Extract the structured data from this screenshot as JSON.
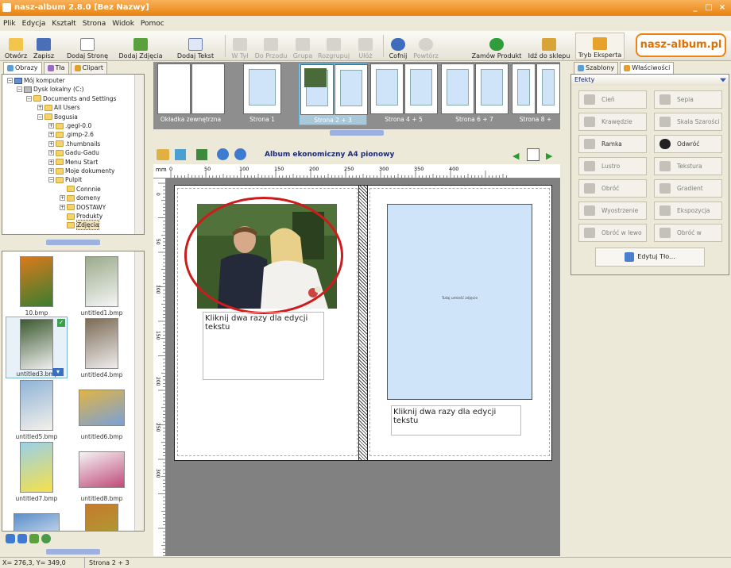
{
  "window": {
    "title": "nasz-album 2.8.0 [Bez Nazwy]",
    "controls": [
      "_",
      "□",
      "×"
    ]
  },
  "menu": [
    "Plik",
    "Edycja",
    "Kształt",
    "Strona",
    "Widok",
    "Pomoc"
  ],
  "toolbar": {
    "open": "Otwórz",
    "save": "Zapisz",
    "add_page": "Dodaj Stronę",
    "add_photos": "Dodaj Zdjęcia",
    "add_text": "Dodaj Tekst",
    "to_back": "W Tył",
    "to_front": "Do Przodu",
    "group": "Grupa",
    "ungroup": "Rozgrupuj",
    "arrange": "Ułóż",
    "undo": "Cofnij",
    "redo": "Powtórz",
    "order_product": "Zamów Produkt",
    "go_to_shop": "Idź do sklepu",
    "expert_mode": "Tryb Eksperta",
    "logo": "nasz-album.pl"
  },
  "left_tabs": [
    "Obrazy",
    "Tła",
    "Clipart"
  ],
  "tree": [
    {
      "label": "Mój komputer",
      "level": 0,
      "kind": "pc",
      "expander": "−"
    },
    {
      "label": "Dysk lokalny (C:)",
      "level": 1,
      "kind": "drive",
      "expander": "−"
    },
    {
      "label": "Documents and Settings",
      "level": 2,
      "kind": "folder",
      "expander": "−"
    },
    {
      "label": "All Users",
      "level": 3,
      "kind": "folder",
      "expander": "+"
    },
    {
      "label": "Bogusia",
      "level": 3,
      "kind": "folder",
      "expander": "−"
    },
    {
      "label": ".gegl-0.0",
      "level": 4,
      "kind": "folder",
      "expander": "+"
    },
    {
      "label": ".gimp-2.6",
      "level": 4,
      "kind": "folder",
      "expander": "+"
    },
    {
      "label": ".thumbnails",
      "level": 4,
      "kind": "folder",
      "expander": "+"
    },
    {
      "label": "Gadu-Gadu",
      "level": 4,
      "kind": "folder",
      "expander": "+"
    },
    {
      "label": "Menu Start",
      "level": 4,
      "kind": "folder",
      "expander": "+"
    },
    {
      "label": "Moje dokumenty",
      "level": 4,
      "kind": "folder",
      "expander": "+"
    },
    {
      "label": "Pulpit",
      "level": 4,
      "kind": "folder",
      "expander": "−"
    },
    {
      "label": "Connnie",
      "level": 5,
      "kind": "folder",
      "expander": ""
    },
    {
      "label": "domeny",
      "level": 5,
      "kind": "folder",
      "expander": "+"
    },
    {
      "label": "DOSTAWY",
      "level": 5,
      "kind": "folder",
      "expander": "+"
    },
    {
      "label": "Produkty",
      "level": 5,
      "kind": "folder",
      "expander": ""
    },
    {
      "label": "Zdjęcia",
      "level": 5,
      "kind": "folder",
      "expander": "",
      "selected": true
    }
  ],
  "thumbnails": [
    {
      "label": "10.bmp"
    },
    {
      "label": "untitled1.bmp"
    },
    {
      "label": "untitled3.bmp",
      "selected": true
    },
    {
      "label": "untitled4.bmp"
    },
    {
      "label": "untitled5.bmp"
    },
    {
      "label": "untitled6.bmp"
    },
    {
      "label": "untitled7.bmp"
    },
    {
      "label": "untitled8.bmp"
    },
    {
      "label": ""
    },
    {
      "label": ""
    }
  ],
  "pages": [
    "Okładka zewnętrzna",
    "Strona 1",
    "Strona 2 + 3",
    "Strona 4 + 5",
    "Strona 6 + 7",
    "Strona 8 +"
  ],
  "editor": {
    "album_title": "Album ekonomiczny A4 pionowy",
    "ruler_unit": "mm",
    "ruler_h": [
      "0",
      "50",
      "100",
      "150",
      "200",
      "250",
      "300",
      "350",
      "400"
    ],
    "ruler_v": [
      "0",
      "50",
      "100",
      "150",
      "200",
      "250",
      "300"
    ]
  },
  "spread": {
    "text_left": "Kliknij dwa razy dla edycji tekstu",
    "placeholder": "Tutaj umieść zdjęcie",
    "text_right": "Kliknij dwa razy dla edycji tekstu"
  },
  "right_tabs": [
    "Szablony",
    "Właściwości"
  ],
  "effects": {
    "header": "Efekty",
    "items": [
      "Cień",
      "Sepia",
      "Krawędzie",
      "Skala Szarości",
      "Ramka",
      "Odwróć",
      "Lustro",
      "Tekstura",
      "Obróć",
      "Gradient",
      "Wyostrzenie",
      "Ekspozycja",
      "Obróć w lewo",
      "Obróć w prawo"
    ],
    "edit_background": "Edytuj Tło..."
  },
  "status": {
    "coords": "X= 276,3, Y= 349,0",
    "page": "Strona 2 + 3"
  },
  "colors": {
    "accent": "#f08010",
    "selection": "#5ab5d8",
    "ellipse": "#cc1c1c",
    "placeholder": "#cfe4f8"
  }
}
